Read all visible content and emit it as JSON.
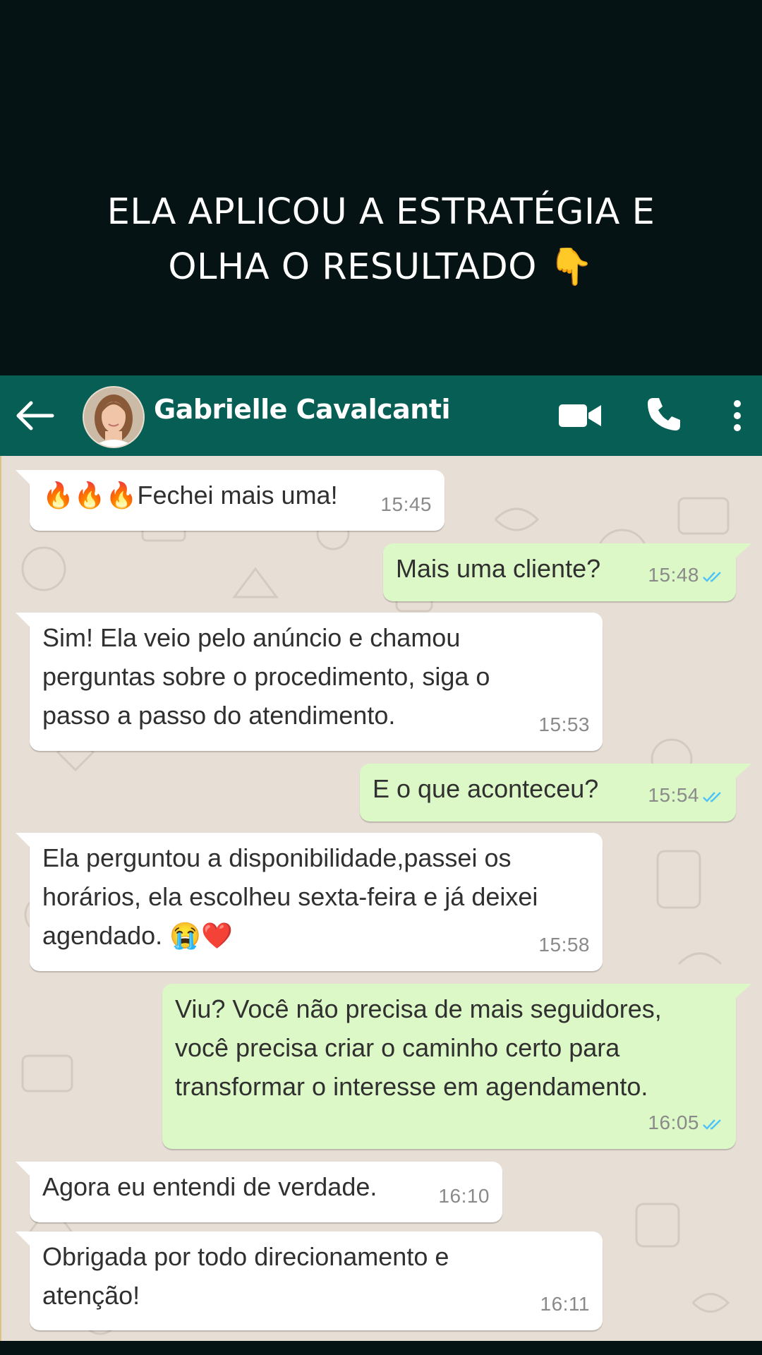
{
  "headline": {
    "line1": "ELA APLICOU A ESTRATÉGIA E",
    "line2": "OLHA O RESULTADO 👇"
  },
  "header": {
    "contact_name": "Gabrielle Cavalcanti",
    "icons": [
      "back-arrow-icon",
      "video-call-icon",
      "phone-call-icon",
      "more-options-icon"
    ]
  },
  "messages": [
    {
      "direction": "incoming",
      "text": "Fechei mais uma!",
      "prefix_emoji": "🔥🔥🔥",
      "time": "15:45"
    },
    {
      "direction": "outgoing",
      "text": "Mais uma cliente?",
      "time": "15:48",
      "status": "read"
    },
    {
      "direction": "incoming",
      "text": "Sim! Ela veio pelo anúncio e chamou\nperguntas sobre o procedimento, siga o\npasso a passo do atendimento.",
      "time": "15:53"
    },
    {
      "direction": "outgoing",
      "text": "E o que aconteceu?",
      "time": "15:54",
      "status": "read"
    },
    {
      "direction": "incoming",
      "text": "Ela perguntou a disponibilidade,passei os\nhorários, ela escolheu sexta-feira e já deixei\nagendado. 😭❤️",
      "time": "15:58"
    },
    {
      "direction": "outgoing",
      "text": "Viu? Você não precisa de mais seguidores,\nvocê precisa criar o caminho certo para\ntransformar o interesse em agendamento.",
      "time": "16:05",
      "status": "read"
    },
    {
      "direction": "incoming",
      "text": "Agora eu entendi de verdade.",
      "time": "16:10"
    },
    {
      "direction": "incoming",
      "text": "Obrigada por todo direcionamento e\natenção!",
      "time": "16:11"
    }
  ],
  "colors": {
    "background": "#061314",
    "header": "#075e54",
    "chat_wallpaper": "#e7ded5",
    "incoming_bubble": "#ffffff",
    "outgoing_bubble": "#dcf8c6",
    "read_ticks": "#4fc3f7"
  }
}
